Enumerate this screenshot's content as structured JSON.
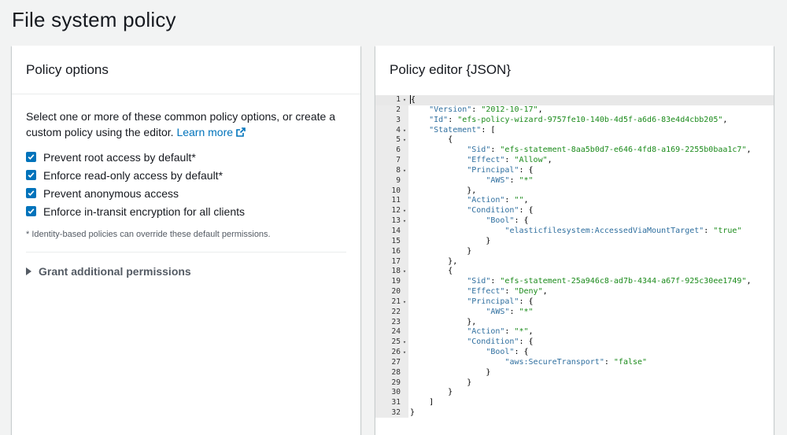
{
  "page": {
    "title": "File system policy"
  },
  "policy_options": {
    "title": "Policy options",
    "intro": "Select one or more of these common policy options, or create a custom policy using the editor.",
    "learn_more": "Learn more",
    "checkboxes": [
      {
        "label": "Prevent root access by default*",
        "checked": true
      },
      {
        "label": "Enforce read-only access by default*",
        "checked": true
      },
      {
        "label": "Prevent anonymous access",
        "checked": true
      },
      {
        "label": "Enforce in-transit encryption for all clients",
        "checked": true
      }
    ],
    "note": "* Identity-based policies can override these default permissions.",
    "grant_label": "Grant additional permissions"
  },
  "editor": {
    "title": "Policy editor {JSON}",
    "lines": [
      {
        "n": "1",
        "fold": true,
        "indent": 0,
        "parts": [
          [
            "p",
            "{"
          ]
        ]
      },
      {
        "n": "2",
        "fold": false,
        "indent": 4,
        "parts": [
          [
            "k",
            "\"Version\""
          ],
          [
            "p",
            ": "
          ],
          [
            "s",
            "\"2012-10-17\""
          ],
          [
            "p",
            ","
          ]
        ]
      },
      {
        "n": "3",
        "fold": false,
        "indent": 4,
        "parts": [
          [
            "k",
            "\"Id\""
          ],
          [
            "p",
            ": "
          ],
          [
            "s",
            "\"efs-policy-wizard-9757fe10-140b-4d5f-a6d6-83e4d4cbb205\""
          ],
          [
            "p",
            ","
          ]
        ]
      },
      {
        "n": "4",
        "fold": true,
        "indent": 4,
        "parts": [
          [
            "k",
            "\"Statement\""
          ],
          [
            "p",
            ": ["
          ]
        ]
      },
      {
        "n": "5",
        "fold": true,
        "indent": 8,
        "parts": [
          [
            "p",
            "{"
          ]
        ]
      },
      {
        "n": "6",
        "fold": false,
        "indent": 12,
        "parts": [
          [
            "k",
            "\"Sid\""
          ],
          [
            "p",
            ": "
          ],
          [
            "s",
            "\"efs-statement-8aa5b0d7-e646-4fd8-a169-2255b0baa1c7\""
          ],
          [
            "p",
            ","
          ]
        ]
      },
      {
        "n": "7",
        "fold": false,
        "indent": 12,
        "parts": [
          [
            "k",
            "\"Effect\""
          ],
          [
            "p",
            ": "
          ],
          [
            "s",
            "\"Allow\""
          ],
          [
            "p",
            ","
          ]
        ]
      },
      {
        "n": "8",
        "fold": true,
        "indent": 12,
        "parts": [
          [
            "k",
            "\"Principal\""
          ],
          [
            "p",
            ": {"
          ]
        ]
      },
      {
        "n": "9",
        "fold": false,
        "indent": 16,
        "parts": [
          [
            "k",
            "\"AWS\""
          ],
          [
            "p",
            ": "
          ],
          [
            "s",
            "\"*\""
          ]
        ]
      },
      {
        "n": "10",
        "fold": false,
        "indent": 12,
        "parts": [
          [
            "p",
            "},"
          ]
        ]
      },
      {
        "n": "11",
        "fold": false,
        "indent": 12,
        "parts": [
          [
            "k",
            "\"Action\""
          ],
          [
            "p",
            ": "
          ],
          [
            "s",
            "\"\""
          ],
          [
            "p",
            ","
          ]
        ]
      },
      {
        "n": "12",
        "fold": true,
        "indent": 12,
        "parts": [
          [
            "k",
            "\"Condition\""
          ],
          [
            "p",
            ": {"
          ]
        ]
      },
      {
        "n": "13",
        "fold": true,
        "indent": 16,
        "parts": [
          [
            "k",
            "\"Bool\""
          ],
          [
            "p",
            ": {"
          ]
        ]
      },
      {
        "n": "14",
        "fold": false,
        "indent": 20,
        "parts": [
          [
            "k",
            "\"elasticfilesystem:AccessedViaMountTarget\""
          ],
          [
            "p",
            ": "
          ],
          [
            "s",
            "\"true\""
          ]
        ]
      },
      {
        "n": "15",
        "fold": false,
        "indent": 16,
        "parts": [
          [
            "p",
            "}"
          ]
        ]
      },
      {
        "n": "16",
        "fold": false,
        "indent": 12,
        "parts": [
          [
            "p",
            "}"
          ]
        ]
      },
      {
        "n": "17",
        "fold": false,
        "indent": 8,
        "parts": [
          [
            "p",
            "},"
          ]
        ]
      },
      {
        "n": "18",
        "fold": true,
        "indent": 8,
        "parts": [
          [
            "p",
            "{"
          ]
        ]
      },
      {
        "n": "19",
        "fold": false,
        "indent": 12,
        "parts": [
          [
            "k",
            "\"Sid\""
          ],
          [
            "p",
            ": "
          ],
          [
            "s",
            "\"efs-statement-25a946c8-ad7b-4344-a67f-925c30ee1749\""
          ],
          [
            "p",
            ","
          ]
        ]
      },
      {
        "n": "20",
        "fold": false,
        "indent": 12,
        "parts": [
          [
            "k",
            "\"Effect\""
          ],
          [
            "p",
            ": "
          ],
          [
            "s",
            "\"Deny\""
          ],
          [
            "p",
            ","
          ]
        ]
      },
      {
        "n": "21",
        "fold": true,
        "indent": 12,
        "parts": [
          [
            "k",
            "\"Principal\""
          ],
          [
            "p",
            ": {"
          ]
        ]
      },
      {
        "n": "22",
        "fold": false,
        "indent": 16,
        "parts": [
          [
            "k",
            "\"AWS\""
          ],
          [
            "p",
            ": "
          ],
          [
            "s",
            "\"*\""
          ]
        ]
      },
      {
        "n": "23",
        "fold": false,
        "indent": 12,
        "parts": [
          [
            "p",
            "},"
          ]
        ]
      },
      {
        "n": "24",
        "fold": false,
        "indent": 12,
        "parts": [
          [
            "k",
            "\"Action\""
          ],
          [
            "p",
            ": "
          ],
          [
            "s",
            "\"*\""
          ],
          [
            "p",
            ","
          ]
        ]
      },
      {
        "n": "25",
        "fold": true,
        "indent": 12,
        "parts": [
          [
            "k",
            "\"Condition\""
          ],
          [
            "p",
            ": {"
          ]
        ]
      },
      {
        "n": "26",
        "fold": true,
        "indent": 16,
        "parts": [
          [
            "k",
            "\"Bool\""
          ],
          [
            "p",
            ": {"
          ]
        ]
      },
      {
        "n": "27",
        "fold": false,
        "indent": 20,
        "parts": [
          [
            "k",
            "\"aws:SecureTransport\""
          ],
          [
            "p",
            ": "
          ],
          [
            "s",
            "\"false\""
          ]
        ]
      },
      {
        "n": "28",
        "fold": false,
        "indent": 16,
        "parts": [
          [
            "p",
            "}"
          ]
        ]
      },
      {
        "n": "29",
        "fold": false,
        "indent": 12,
        "parts": [
          [
            "p",
            "}"
          ]
        ]
      },
      {
        "n": "30",
        "fold": false,
        "indent": 8,
        "parts": [
          [
            "p",
            "}"
          ]
        ]
      },
      {
        "n": "31",
        "fold": false,
        "indent": 4,
        "parts": [
          [
            "p",
            "]"
          ]
        ]
      },
      {
        "n": "32",
        "fold": false,
        "indent": 0,
        "parts": [
          [
            "p",
            "}"
          ]
        ]
      }
    ]
  },
  "colors": {
    "accent": "#0073bb",
    "json_key": "#2f6f9f",
    "json_string": "#1a8a1a"
  },
  "icons": {
    "checkbox": "check-icon",
    "external": "external-link-icon",
    "expander": "caret-right-icon",
    "fold": "fold-arrow-icon"
  }
}
